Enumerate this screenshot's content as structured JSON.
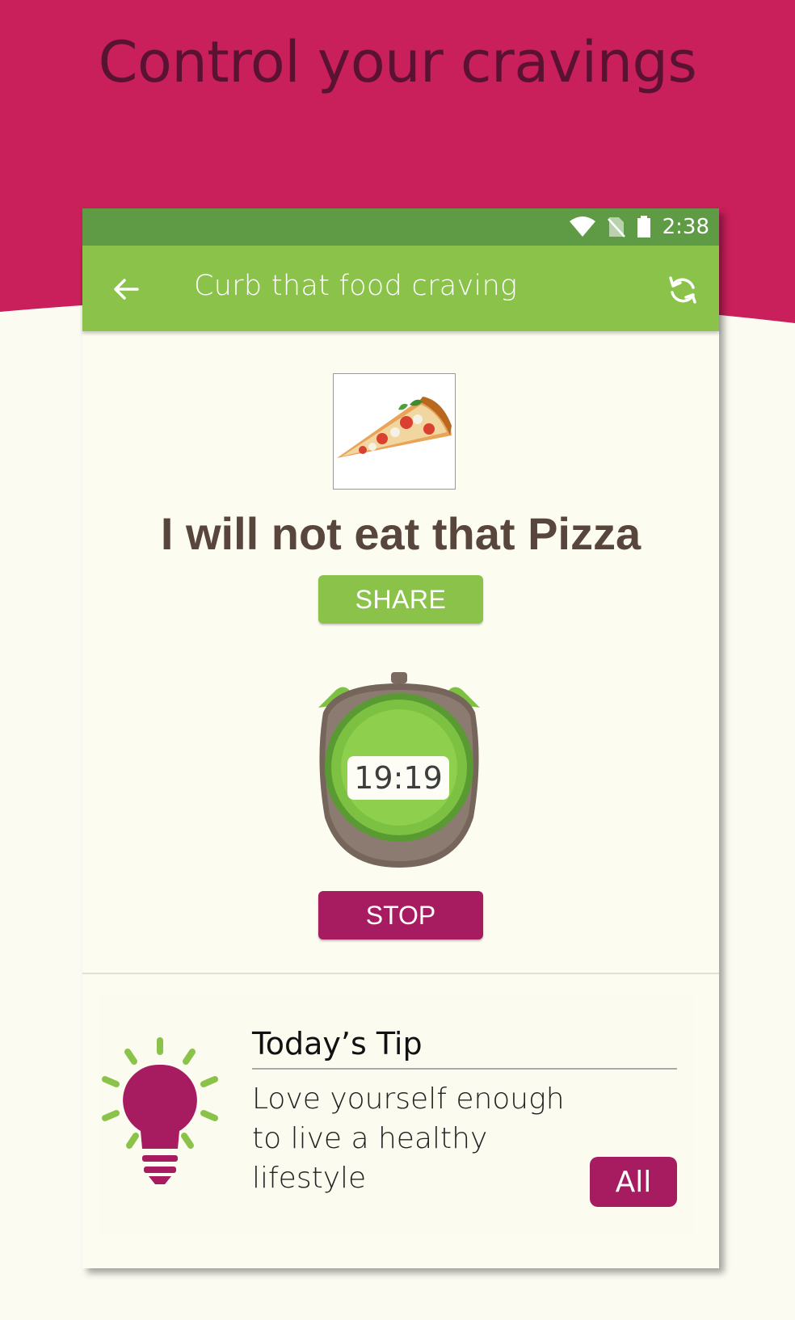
{
  "promo": {
    "headline": "Control your cravings"
  },
  "status_bar": {
    "time": "2:38",
    "icons": [
      "wifi-icon",
      "no-sim-icon",
      "battery-icon"
    ]
  },
  "app_bar": {
    "title": "Curb that food craving",
    "back_icon": "arrow-left-icon",
    "refresh_icon": "refresh-icon"
  },
  "craving": {
    "image": "pizza-slice",
    "pledge": "I will not eat that Pizza",
    "share_label": "SHARE"
  },
  "timer": {
    "value": "19:19",
    "stop_label": "STOP"
  },
  "tip": {
    "title": "Today’s Tip",
    "line1": "Love yourself enough",
    "line2": "to live a healthy",
    "line3": "lifestyle",
    "all_label": "All",
    "icon": "lightbulb-icon"
  },
  "colors": {
    "brand_magenta": "#c91f5b",
    "button_magenta": "#a71c60",
    "app_green": "#8bc34a",
    "status_green": "#5f9a45",
    "background": "#fbfbf2"
  }
}
